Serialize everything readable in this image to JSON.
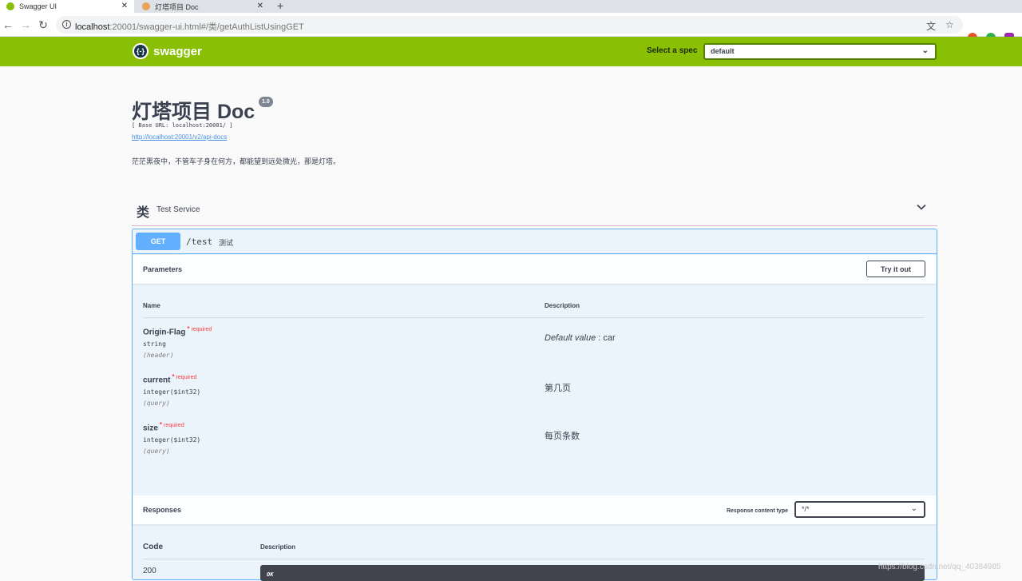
{
  "browser": {
    "tabs": [
      {
        "title": "Swagger UI",
        "favicon_color": "#89bf04"
      },
      {
        "title": "灯塔项目 Doc",
        "favicon_color": "#e8a25a"
      }
    ],
    "tab_close": "✕",
    "new_tab": "+",
    "url_host": "localhost",
    "url_path": ":20001/swagger-ui.html#/类/getAuthListUsingGET",
    "info_glyph": "i"
  },
  "topbar": {
    "logo_mark": "{-}",
    "logo_text": "swagger",
    "spec_label": "Select a spec",
    "spec_value": "default"
  },
  "info": {
    "title": "灯塔项目 Doc",
    "version": "1.0",
    "base_url": "[ Base URL: localhost:20001/ ]",
    "api_docs_link": "http://localhost:20001/v2/api-docs",
    "description": "茫茫黑夜中，不管车子身在何方，都能望到远处微光，那是灯塔。"
  },
  "tag": {
    "name": "类",
    "description": "Test Service"
  },
  "operation": {
    "method": "GET",
    "path": "/test",
    "summary": "测试",
    "parameters_label": "Parameters",
    "try_it_out": "Try it out",
    "col_name": "Name",
    "col_description": "Description",
    "required_label": "required",
    "required_star": "*",
    "params": [
      {
        "name": "Origin-Flag",
        "type": "string",
        "in": "(header)",
        "desc_prefix": "Default value",
        "desc_sep": " : ",
        "desc_value": "car",
        "description": ""
      },
      {
        "name": "current",
        "type": "integer($int32)",
        "in": "(query)",
        "description": "第几页"
      },
      {
        "name": "size",
        "type": "integer($int32)",
        "in": "(query)",
        "description": "每页条数"
      }
    ],
    "responses_label": "Responses",
    "response_content_type_label": "Response content type",
    "response_content_type": "*/*",
    "col_code": "Code",
    "responses": [
      {
        "code": "200",
        "description": "OK"
      }
    ]
  },
  "watermark": "https://blog.csdn.net/qq_40384985",
  "colors": {
    "topbar": "#89bf04",
    "get": "#61affe",
    "required": "#f93e3e"
  }
}
